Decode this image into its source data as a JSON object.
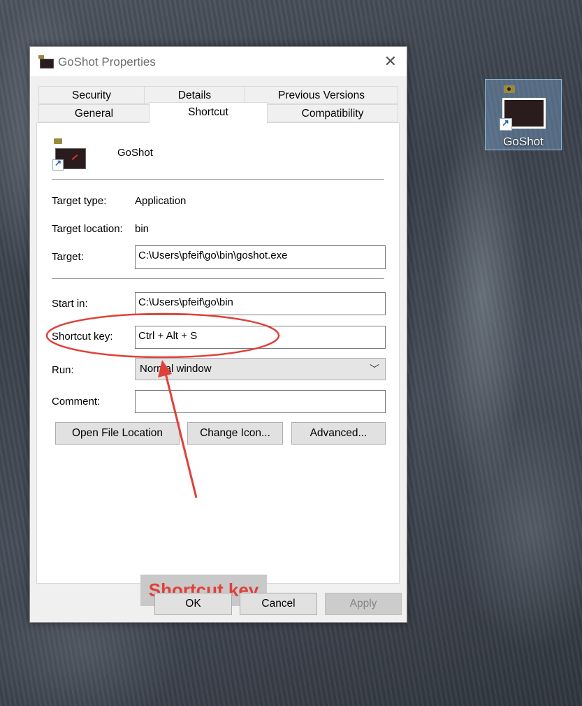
{
  "desktop": {
    "shortcut_label": "GoShot",
    "icons": {
      "app": "goshot-app-icon",
      "shortcut_overlay": "shortcut-arrow-icon"
    }
  },
  "window": {
    "title": "GoShot Properties",
    "close_glyph": "✕",
    "tabs_row1": [
      {
        "label": "Security"
      },
      {
        "label": "Details"
      },
      {
        "label": "Previous Versions"
      }
    ],
    "tabs_row2": [
      {
        "label": "General"
      },
      {
        "label": "Shortcut",
        "active": true
      },
      {
        "label": "Compatibility"
      }
    ]
  },
  "shortcut": {
    "app_name": "GoShot",
    "target_type_label": "Target type:",
    "target_type_value": "Application",
    "target_location_label": "Target location:",
    "target_location_value": "bin",
    "target_label": "Target:",
    "target_value": "C:\\Users\\pfeif\\go\\bin\\goshot.exe",
    "start_in_label": "Start in:",
    "start_in_value": "C:\\Users\\pfeif\\go\\bin",
    "shortcut_key_label": "Shortcut key:",
    "shortcut_key_value": "Ctrl + Alt + S",
    "run_label": "Run:",
    "run_value": "Normal window",
    "comment_label": "Comment:",
    "comment_value": "",
    "open_file_location": "Open File Location",
    "change_icon": "Change Icon...",
    "advanced": "Advanced..."
  },
  "footer": {
    "ok": "OK",
    "cancel": "Cancel",
    "apply": "Apply"
  },
  "annotation": {
    "text": "Shortcut key",
    "color": "#e0403a"
  }
}
